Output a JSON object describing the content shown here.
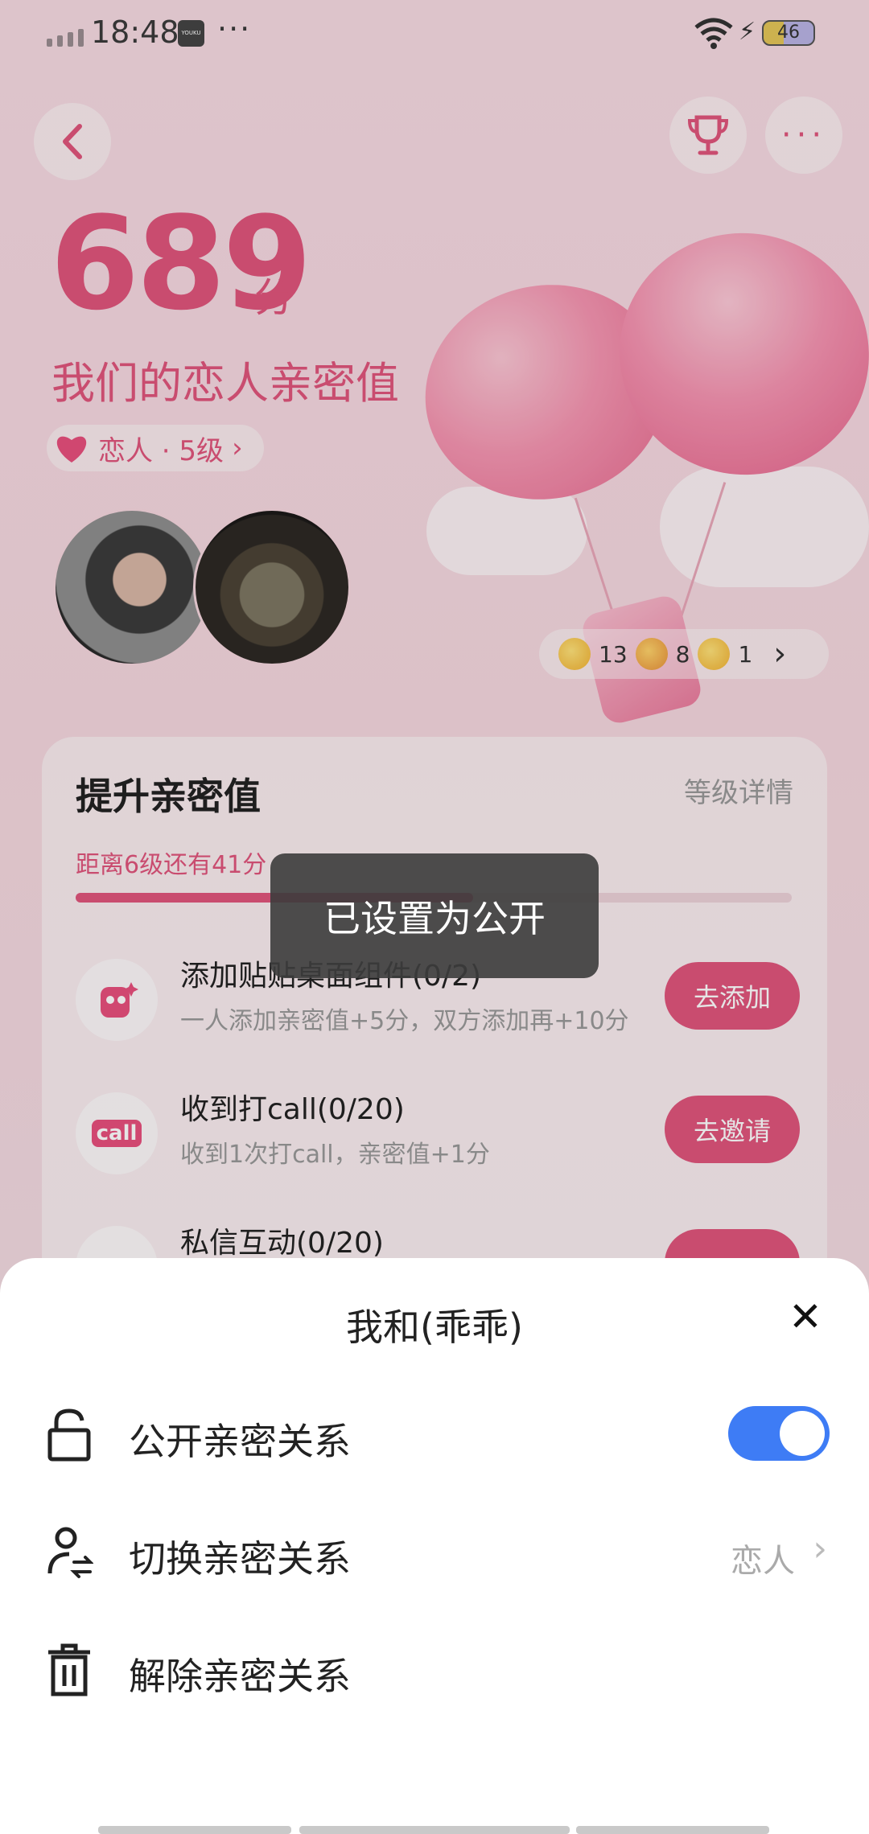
{
  "status_bar": {
    "time": "18:48",
    "app_badge": "YOUKU",
    "overflow": "···",
    "battery": "46"
  },
  "header": {
    "back_icon": "chevron-left-icon",
    "trophy_icon": "trophy-icon",
    "more_label": "···"
  },
  "intimacy": {
    "score": "689",
    "score_unit": "分",
    "title": "我们的恋人亲密值",
    "level_label": "恋人 · 5级",
    "level_chevron": "›"
  },
  "reactions": [
    {
      "icon": "hug-emoji-icon",
      "count": "13"
    },
    {
      "icon": "party-popper-icon",
      "count": "8"
    },
    {
      "icon": "smile-emoji-icon",
      "count": "1"
    }
  ],
  "reactions_chevron": "›",
  "card": {
    "title": "提升亲密值",
    "detail_link": "等级详情",
    "progress_text": "距离6级还有41分",
    "progress_fraction": 0.555,
    "tasks": [
      {
        "icon": "sticker-icon",
        "title": "添加贴贴桌面组件(0/2)",
        "desc": "一人添加亲密值+5分，双方添加再+10分",
        "button": "去添加"
      },
      {
        "icon": "call-icon",
        "icon_text": "call",
        "title": "收到打call(0/20)",
        "desc": "收到1次打call，亲密值+1分",
        "button": "去邀请"
      },
      {
        "icon": "message-icon",
        "title": "私信互动(0/20)",
        "desc": "",
        "button": ""
      }
    ]
  },
  "toast": "已设置为公开",
  "sheet": {
    "title": "我和(乖乖)",
    "close": "✕",
    "rows": [
      {
        "icon": "unlock-icon",
        "label": "公开亲密关系",
        "toggle_on": true
      },
      {
        "icon": "switch-user-icon",
        "label": "切换亲密关系",
        "value": "恋人",
        "chevron": "›"
      },
      {
        "icon": "trash-icon",
        "label": "解除亲密关系"
      }
    ]
  },
  "colors": {
    "accent": "#e0557c",
    "toggle": "#3e7cf5"
  }
}
